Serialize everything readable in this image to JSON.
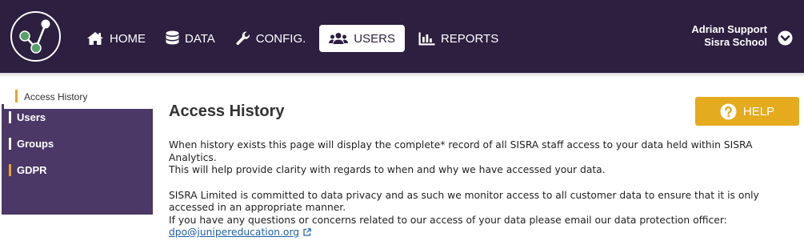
{
  "nav": {
    "items": [
      {
        "label": "HOME",
        "icon": "home-icon"
      },
      {
        "label": "DATA",
        "icon": "database-icon"
      },
      {
        "label": "CONFIG.",
        "icon": "wrench-icon"
      },
      {
        "label": "USERS",
        "icon": "users-icon",
        "active": true
      },
      {
        "label": "REPORTS",
        "icon": "bar-chart-icon"
      }
    ]
  },
  "user": {
    "name": "Adrian Support",
    "school": "Sisra School",
    "toggle_icon": "chevron-down-circle-icon"
  },
  "sidebar": {
    "items": [
      {
        "label": "Users"
      },
      {
        "label": "Groups"
      },
      {
        "label": "GDPR"
      }
    ],
    "subitem": {
      "label": "Access History"
    }
  },
  "page": {
    "title": "Access History",
    "help_label": "HELP",
    "help_icon": "question-circle-icon",
    "para1_line1": "When history exists this page will display the complete* record of all SISRA staff access to your data held within SISRA Analytics.",
    "para1_line2": "This will help provide clarity with regards to when and why we have accessed your data.",
    "para2_line1": "SISRA Limited is committed to data privacy and as such we monitor access to all customer data to ensure that it is only accessed in an appropriate manner.",
    "para2_line2": "If you have any questions or concerns related to our access of your data please email our data protection officer:",
    "email": "dpo@junipereducation.org",
    "email_icon": "external-link-icon"
  },
  "colors": {
    "topbar": "#2c1f40",
    "sidebar": "#4b3866",
    "accent": "#e5ab1f",
    "link": "#1f5fa8"
  }
}
